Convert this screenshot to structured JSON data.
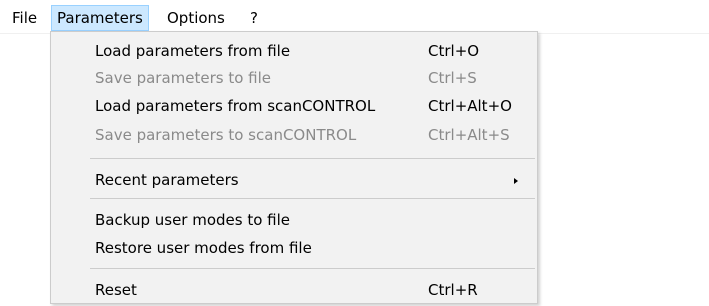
{
  "menubar": {
    "items": [
      {
        "label": "File"
      },
      {
        "label": "Parameters"
      },
      {
        "label": "Options"
      },
      {
        "label": "?"
      }
    ]
  },
  "parameters_menu": {
    "items": [
      {
        "label": "Load parameters from file",
        "shortcut": "Ctrl+O",
        "enabled": true
      },
      {
        "label": "Save parameters to file",
        "shortcut": "Ctrl+S",
        "enabled": false
      },
      {
        "label": "Load parameters from scanCONTROL",
        "shortcut": "Ctrl+Alt+O",
        "enabled": true
      },
      {
        "label": "Save parameters to scanCONTROL",
        "shortcut": "Ctrl+Alt+S",
        "enabled": false
      },
      {
        "label": "Recent parameters",
        "enabled": true,
        "has_submenu": true
      },
      {
        "label": "Backup user modes to file",
        "enabled": true
      },
      {
        "label": "Restore user modes from file",
        "enabled": true
      },
      {
        "label": "Reset",
        "shortcut": "Ctrl+R",
        "enabled": true
      }
    ]
  },
  "colors": {
    "menu_background": "#f2f2f2",
    "active_highlight": "#cce8ff",
    "active_border": "#99d1ff",
    "disabled_text": "#8a8a8a",
    "separator": "#cccccc"
  }
}
